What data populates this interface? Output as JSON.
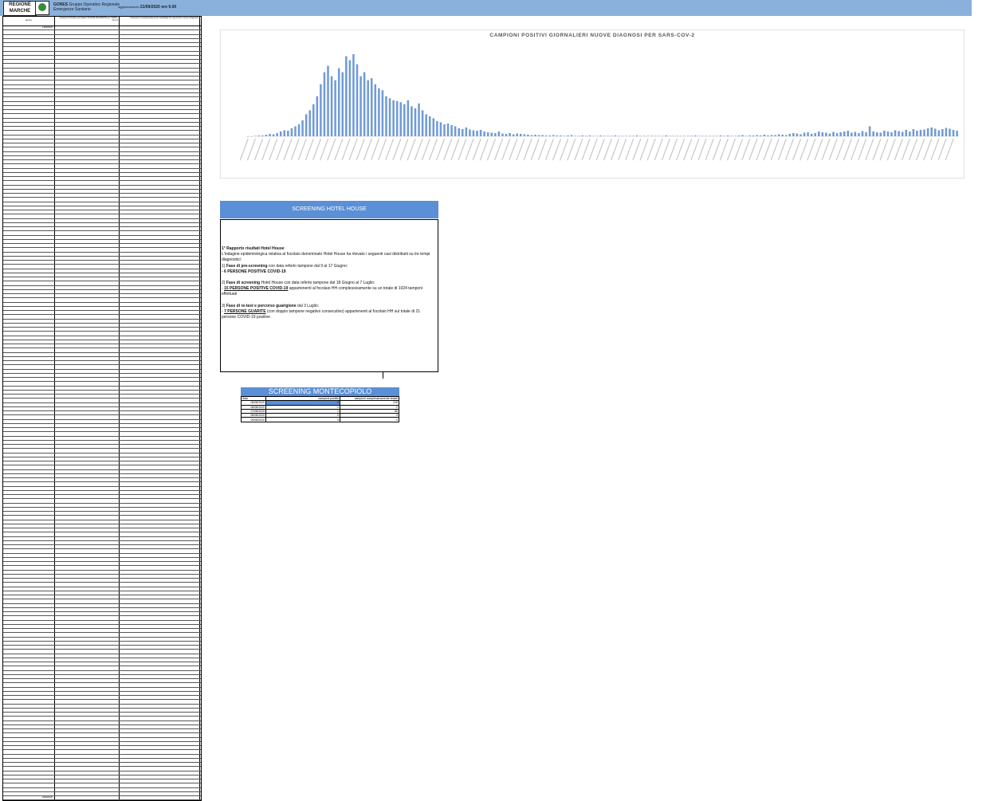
{
  "header": {
    "logo_text": "REGIONE MARCHE",
    "org_name": "GORES",
    "org_subtitle": "Gruppo Operativo Regionale",
    "org_subtitle2": "Emergenze Sanitarie",
    "update_label": "aggiornamento",
    "update_value": "21/09/2020 ore 9.00"
  },
  "table": {
    "col1": "giorno",
    "col2": "Campioni Positivi giornalieri NUOVE DIAGNOSI per SARS-Cov-2",
    "col3": "Campioni complessivamente testati/giorno (percorso nuove diagnosi)",
    "dates_first": "14/06/2020",
    "dates_last": "20/09/2020"
  },
  "chart_data": {
    "type": "bar",
    "title": "CAMPIONI POSITIVI GIORNALIERI NUOVE DIAGNOSI PER SARS-COV-2",
    "x_range": [
      "24/02/2020",
      "20/09/2020"
    ],
    "values": [
      0,
      0,
      1,
      2,
      2,
      4,
      6,
      5,
      8,
      12,
      15,
      14,
      20,
      25,
      30,
      40,
      55,
      65,
      80,
      100,
      130,
      160,
      176,
      150,
      140,
      170,
      160,
      200,
      190,
      205,
      180,
      150,
      160,
      140,
      145,
      130,
      120,
      115,
      100,
      95,
      90,
      88,
      85,
      80,
      90,
      75,
      70,
      82,
      65,
      55,
      50,
      45,
      38,
      35,
      30,
      32,
      28,
      25,
      20,
      18,
      22,
      17,
      15,
      14,
      16,
      12,
      10,
      9,
      8,
      12,
      7,
      6,
      8,
      5,
      7,
      6,
      5,
      4,
      3,
      4,
      3,
      3,
      2,
      2,
      3,
      2,
      2,
      1,
      2,
      3,
      1,
      1,
      2,
      1,
      2,
      1,
      1,
      2,
      1,
      1,
      1,
      2,
      1,
      1,
      1,
      1,
      1,
      2,
      1,
      1,
      1,
      1,
      1,
      1,
      1,
      2,
      1,
      1,
      1,
      1,
      1,
      1,
      1,
      2,
      1,
      1,
      1,
      1,
      1,
      1,
      2,
      1,
      2,
      1,
      1,
      2,
      3,
      1,
      2,
      2,
      3,
      2,
      4,
      2,
      3,
      3,
      5,
      4,
      3,
      6,
      8,
      7,
      5,
      9,
      10,
      6,
      8,
      12,
      10,
      9,
      7,
      11,
      8,
      10,
      12,
      14,
      9,
      11,
      8,
      13,
      10,
      25,
      12,
      10,
      9,
      14,
      12,
      10,
      15,
      13,
      11,
      16,
      12,
      18,
      14,
      16,
      17,
      20,
      22,
      19,
      15,
      18,
      21,
      19,
      16,
      14
    ],
    "grid": false
  },
  "hotel_house": {
    "title": "SCREENING HOTEL HOUSE",
    "p1_bold": "1° Rapporto  risultati Hotel House",
    "p1_rest": ":",
    "p2": "L'indagine epidemiologica relativa al focolaio denominato Hotel House ha rilevato i seguenti casi distribuiti su tre tempi diagnostici:",
    "p3_num": "1) ",
    "p3_bold": "Fase di pre-screening",
    "p3_rest": " con data referto tampone dal 9 al 17 Giugno:",
    "p4": "- 6 PERSONE POSITIVE COVID-19",
    "p5_num": "2) ",
    "p5_bold": "Fase di screening",
    "p5_rest": " Hotel House con data referto tampone dal 18 Giugno al 7 Luglio:",
    "p6_pre": "- ",
    "p6_bold": "15 PERSONE POSITIVE COVID-19",
    "p6_rest": " appartenenti al focolaio HH complessivamente su un totale di 1024 tamponi effettuati",
    "p7_num": "3) ",
    "p7_bold": "Fase di re-test e percorso guarigione",
    "p7_rest": " dal 3 Luglio:",
    "p8_pre": "- ",
    "p8_bold": "7 PERSONE GUARITE",
    "p8_rest": " (con doppio tampone negativo consecutivo) appartenenti al focolaio HH sul totale di 21 persone COVID-19 positive"
  },
  "montecopiolo": {
    "title": "SCREENING MONTECOPIOLO",
    "headers": [
      "data",
      "campioni positivi",
      "campioni complessivamente testati"
    ],
    "rows": [
      [
        "05/08/2020",
        "2",
        "215"
      ],
      [
        "06/08/2020",
        "1",
        "2"
      ],
      [
        "07/08/2020",
        "1",
        "86"
      ],
      [
        "08/08/2020",
        "0",
        "3"
      ],
      [
        "09/08/2020",
        "0",
        "0"
      ]
    ]
  }
}
